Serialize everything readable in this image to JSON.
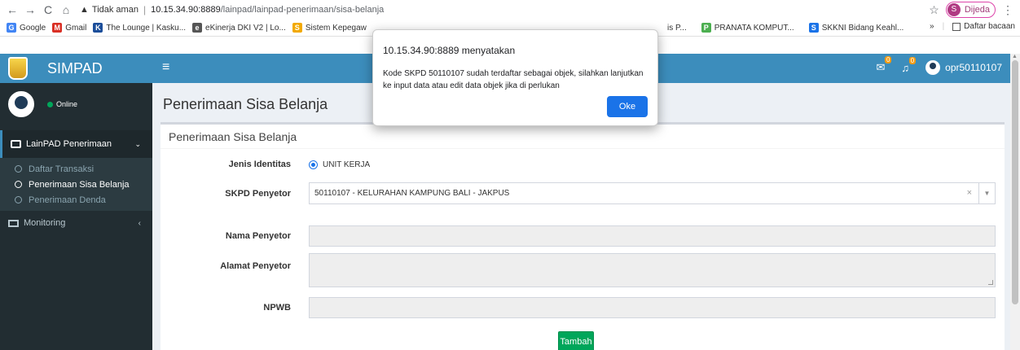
{
  "browser": {
    "back": "←",
    "forward": "→",
    "reload": "C",
    "home": "⌂",
    "security_label": "Tidak aman",
    "url_host": "10.15.34.90:8889",
    "url_path": "/lainpad/lainpad-penerimaan/sisa-belanja",
    "profile_initial": "S",
    "profile_name": "Dijeda",
    "bookmarks": [
      {
        "label": "Google",
        "icon": "G",
        "color": "#4285f4"
      },
      {
        "label": "Gmail",
        "icon": "M",
        "color": "#d93025"
      },
      {
        "label": "The Lounge | Kasku...",
        "icon": "K",
        "color": "#1c4e9a"
      },
      {
        "label": "eKinerja DKI V2 | Lo...",
        "icon": "e",
        "color": "#555555"
      },
      {
        "label": "Sistem Kepegaw",
        "icon": "S",
        "color": "#f2a900"
      }
    ],
    "bookmarks_mid": [
      {
        "label": "is P...",
        "icon": "",
        "color": "#ffffff"
      },
      {
        "label": "PRANATA KOMPUT...",
        "icon": "P",
        "color": "#4caf50"
      },
      {
        "label": "SKKNI Bidang Keahl...",
        "icon": "S",
        "color": "#1a73e8"
      }
    ],
    "more_bookmarks": "»",
    "reading_list": "Daftar bacaan"
  },
  "app": {
    "logo_text": "SIMPAD",
    "menu_toggle": "≡",
    "mail_badge": "0",
    "bell_badge": "0",
    "username": "opr50110107"
  },
  "sidebar": {
    "status": "Online",
    "menu_head": "LainPAD Penerimaan",
    "items": [
      {
        "label": "Daftar Transaksi",
        "active": false
      },
      {
        "label": "Penerimaan Sisa Belanja",
        "active": true
      },
      {
        "label": "Penerimaan Denda",
        "active": false
      }
    ],
    "monitoring": "Monitoring"
  },
  "content": {
    "page_title": "Penerimaan Sisa Belanja",
    "box_title": "Penerimaan Sisa Belanja",
    "form": {
      "jenis_label": "Jenis Identitas",
      "jenis_value": "UNIT KERJA",
      "skpd_label": "SKPD Penyetor",
      "skpd_value": "50110107 - KELURAHAN KAMPUNG BALI - JAKPUS",
      "nama_label": "Nama Penyetor",
      "nama_value": "",
      "alamat_label": "Alamat Penyetor",
      "alamat_value": "",
      "npwb_label": "NPWB",
      "npwb_value": ""
    },
    "add_button": "Tambah"
  },
  "dialog": {
    "title": "10.15.34.90:8889 menyatakan",
    "message": "Kode SKPD 50110107 sudah terdaftar sebagai objek, silahkan lanjutkan ke input data atau edit data objek jika di perlukan",
    "ok": "Oke"
  }
}
